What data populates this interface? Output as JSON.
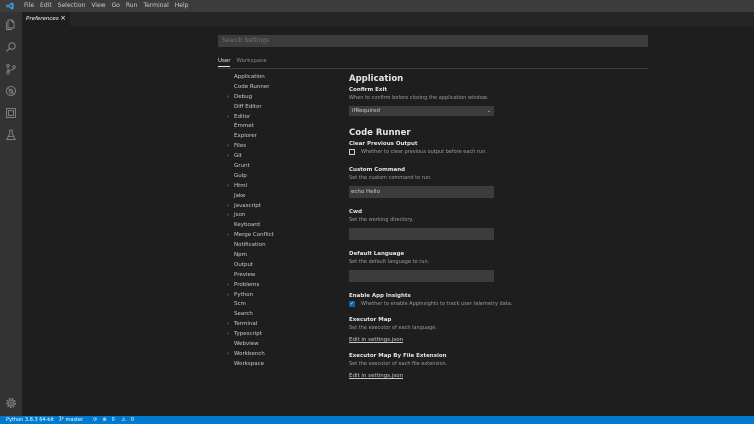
{
  "menubar": {
    "items": [
      "File",
      "Edit",
      "Selection",
      "View",
      "Go",
      "Run",
      "Terminal",
      "Help"
    ]
  },
  "tab": {
    "label": "Preferences",
    "close": "×"
  },
  "search": {
    "placeholder": "Search Settings"
  },
  "scope_tabs": [
    "User",
    "Workspace"
  ],
  "toc": [
    {
      "label": "Application",
      "expandable": false
    },
    {
      "label": "Code Runner",
      "expandable": false
    },
    {
      "label": "Debug",
      "expandable": true
    },
    {
      "label": "Diff Editor",
      "expandable": false
    },
    {
      "label": "Editor",
      "expandable": true
    },
    {
      "label": "Emmet",
      "expandable": false
    },
    {
      "label": "Explorer",
      "expandable": false
    },
    {
      "label": "Files",
      "expandable": true
    },
    {
      "label": "Git",
      "expandable": true
    },
    {
      "label": "Grunt",
      "expandable": false
    },
    {
      "label": "Gulp",
      "expandable": false
    },
    {
      "label": "Html",
      "expandable": true
    },
    {
      "label": "Jake",
      "expandable": false
    },
    {
      "label": "Javascript",
      "expandable": true
    },
    {
      "label": "Json",
      "expandable": true
    },
    {
      "label": "Keyboard",
      "expandable": false
    },
    {
      "label": "Merge Conflict",
      "expandable": true
    },
    {
      "label": "Notification",
      "expandable": false
    },
    {
      "label": "Npm",
      "expandable": false
    },
    {
      "label": "Output",
      "expandable": false
    },
    {
      "label": "Preview",
      "expandable": false
    },
    {
      "label": "Problems",
      "expandable": true
    },
    {
      "label": "Python",
      "expandable": true
    },
    {
      "label": "Scm",
      "expandable": false
    },
    {
      "label": "Search",
      "expandable": false
    },
    {
      "label": "Terminal",
      "expandable": true
    },
    {
      "label": "Typescript",
      "expandable": true
    },
    {
      "label": "Webview",
      "expandable": false
    },
    {
      "label": "Workbench",
      "expandable": true
    },
    {
      "label": "Workspace",
      "expandable": false
    }
  ],
  "content": {
    "application": {
      "title": "Application",
      "confirm_exit": {
        "title": "Confirm Exit",
        "desc": "When to confirm before closing the application window.",
        "value": "ifRequired"
      }
    },
    "code_runner": {
      "title": "Code Runner",
      "clear_previous_output": {
        "title": "Clear Previous Output",
        "desc": "Whether to clear previous output before each run.",
        "checked": false
      },
      "custom_command": {
        "title": "Custom Command",
        "desc": "Set the custom command to run.",
        "value": "echo Hello"
      },
      "cwd": {
        "title": "Cwd",
        "desc": "Set the working directory.",
        "value": ""
      },
      "default_language": {
        "title": "Default Language",
        "desc": "Set the default language to run.",
        "value": ""
      },
      "enable_app_insights": {
        "title": "Enable App Insights",
        "desc": "Whether to enable AppInsights to track user telemetry data.",
        "checked": true
      },
      "executor_map": {
        "title": "Executor Map",
        "desc": "Set the executor of each language.",
        "link": "Edit in settings.json"
      },
      "executor_map_by_file_extension": {
        "title": "Executor Map By File Extension",
        "desc": "Set the executor of each file extension.",
        "link": "Edit in settings.json"
      }
    }
  },
  "statusbar": {
    "python": "Python 3.8.3 64-bit",
    "branch": "master",
    "errors": "0",
    "warnings": "0"
  },
  "colors": {
    "accent": "#007acc",
    "background": "#1e1e1e",
    "activitybar": "#333333",
    "menubar": "#3c3c3c"
  }
}
